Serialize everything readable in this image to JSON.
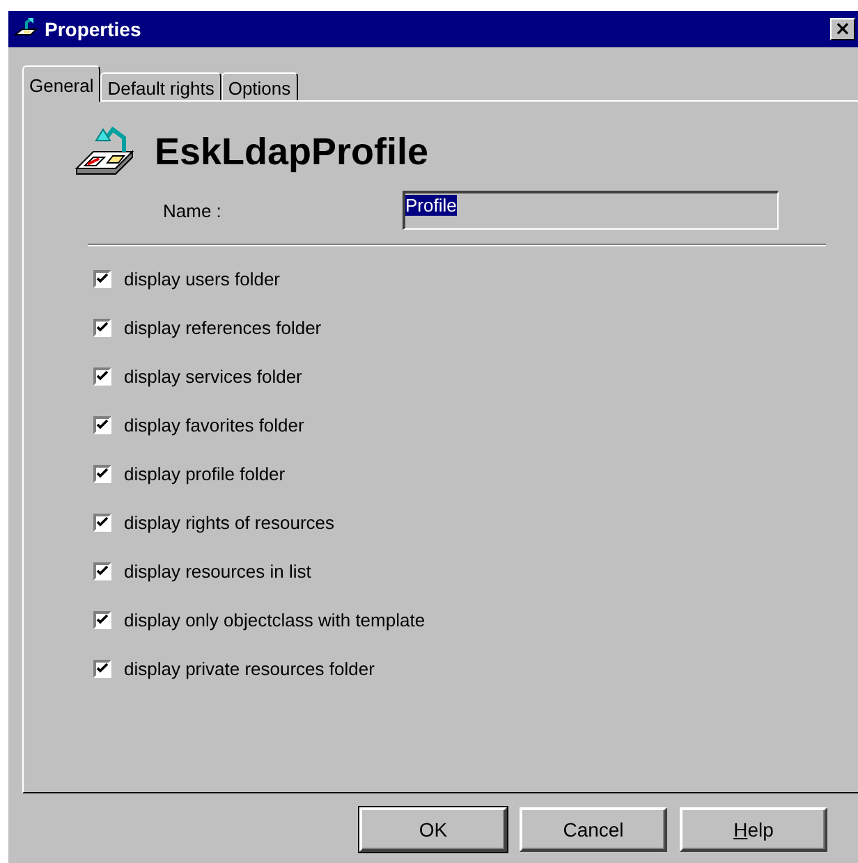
{
  "window": {
    "title": "Properties",
    "close": "×"
  },
  "tabs": [
    {
      "label": "General",
      "selected": true
    },
    {
      "label": "Default rights",
      "selected": false
    },
    {
      "label": "Options",
      "selected": false
    }
  ],
  "header": {
    "title": "EskLdapProfile"
  },
  "name_field": {
    "label": "Name :",
    "value": "Profile"
  },
  "options": [
    {
      "label": "display users folder",
      "checked": true
    },
    {
      "label": "display references folder",
      "checked": true
    },
    {
      "label": "display services folder",
      "checked": true
    },
    {
      "label": "display favorites folder",
      "checked": true
    },
    {
      "label": "display profile folder",
      "checked": true
    },
    {
      "label": "display rights of resources",
      "checked": true
    },
    {
      "label": "display resources in list",
      "checked": true
    },
    {
      "label": "display only objectclass with template",
      "checked": true
    },
    {
      "label": "display private resources folder",
      "checked": true
    }
  ],
  "buttons": [
    {
      "label": "OK",
      "default": true
    },
    {
      "label": "Cancel",
      "default": false
    },
    {
      "label": "Help",
      "default": false
    }
  ]
}
